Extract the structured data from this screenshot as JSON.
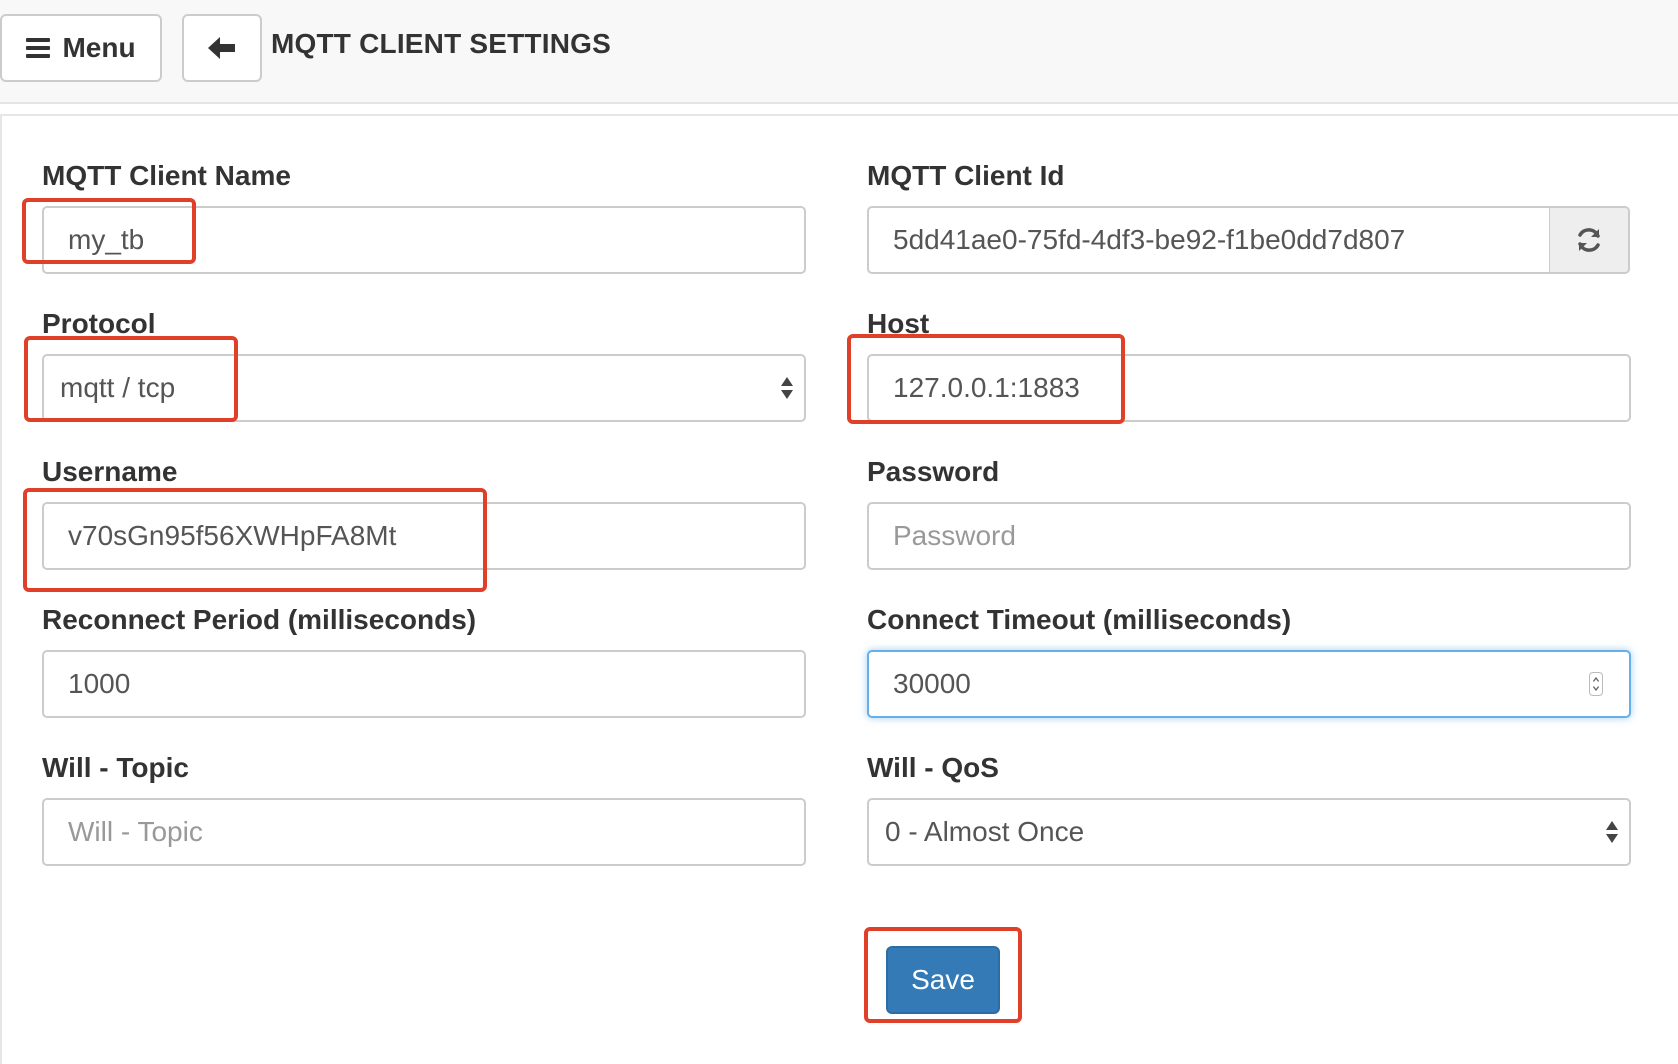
{
  "header": {
    "menu_label": "Menu",
    "title": "MQTT CLIENT SETTINGS"
  },
  "form": {
    "client_name": {
      "label": "MQTT Client Name",
      "value": "my_tb"
    },
    "client_id": {
      "label": "MQTT Client Id",
      "value": "5dd41ae0-75fd-4df3-be92-f1be0dd7d807"
    },
    "protocol": {
      "label": "Protocol",
      "selected": "mqtt / tcp"
    },
    "host": {
      "label": "Host",
      "value": "127.0.0.1:1883"
    },
    "username": {
      "label": "Username",
      "value": "v70sGn95f56XWHpFA8Mt"
    },
    "password": {
      "label": "Password",
      "placeholder": "Password"
    },
    "reconnect_period": {
      "label": "Reconnect Period (milliseconds)",
      "value": "1000"
    },
    "connect_timeout": {
      "label": "Connect Timeout (milliseconds)",
      "value": "30000"
    },
    "will_topic": {
      "label": "Will - Topic",
      "placeholder": "Will - Topic"
    },
    "will_qos": {
      "label": "Will - QoS",
      "selected": "0 - Almost Once"
    },
    "save_label": "Save"
  },
  "colors": {
    "primary_button": "#337ab7",
    "highlight": "#e0402a",
    "focus_border": "#66afe9"
  },
  "icons": {
    "menu": "hamburger-icon",
    "back": "arrow-left-icon",
    "refresh": "refresh-icon",
    "select": "select-arrows-icon"
  }
}
